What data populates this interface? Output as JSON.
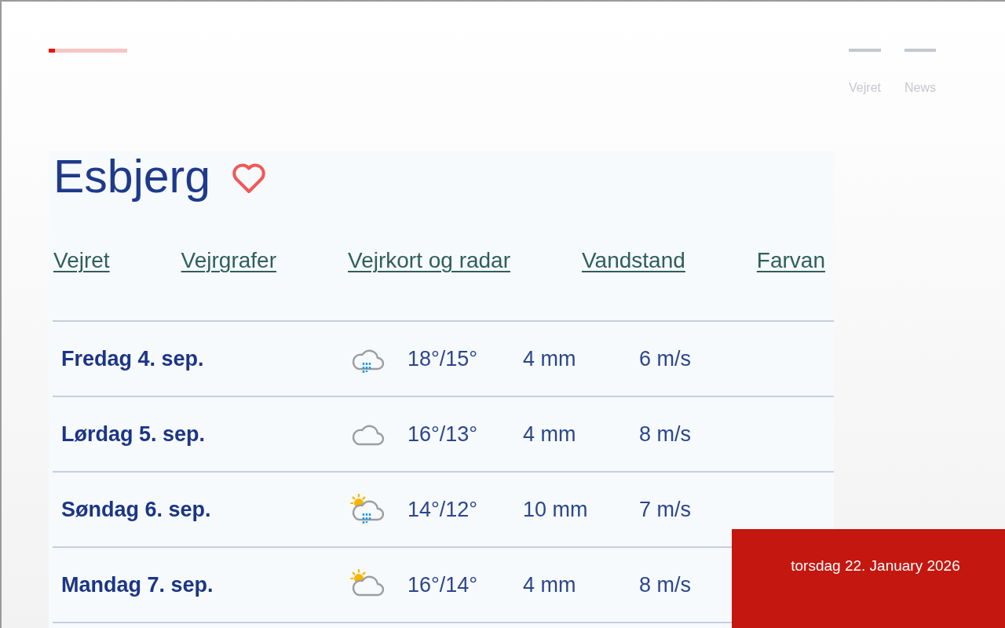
{
  "progress": {
    "level": 0.08
  },
  "nav": [
    {
      "label": "Vejret"
    },
    {
      "label": "News"
    }
  ],
  "location": {
    "title": "Esbjerg",
    "favorite": false
  },
  "links": [
    {
      "label": "Vejret"
    },
    {
      "label": "Vejrgrafer"
    },
    {
      "label": "Vejrkort og radar"
    },
    {
      "label": "Vandstand"
    },
    {
      "label": "Farvan"
    }
  ],
  "forecast": [
    {
      "day": "Fredag 4. sep.",
      "kind": "rain",
      "temp": "18°/15°",
      "precip": "4 mm",
      "wind": "6 m/s"
    },
    {
      "day": "Lørdag 5. sep.",
      "kind": "cloudy",
      "temp": "16°/13°",
      "precip": "4 mm",
      "wind": "8 m/s"
    },
    {
      "day": "Søndag 6. sep.",
      "kind": "partly-cloudy-rain",
      "temp": "14°/12°",
      "precip": "10 mm",
      "wind": "7 m/s"
    },
    {
      "day": "Mandag 7. sep.",
      "kind": "partly-cloudy",
      "temp": "16°/14°",
      "precip": "4 mm",
      "wind": "8 m/s"
    }
  ],
  "date_banner": {
    "text": "torsdag 22. January 2026"
  }
}
